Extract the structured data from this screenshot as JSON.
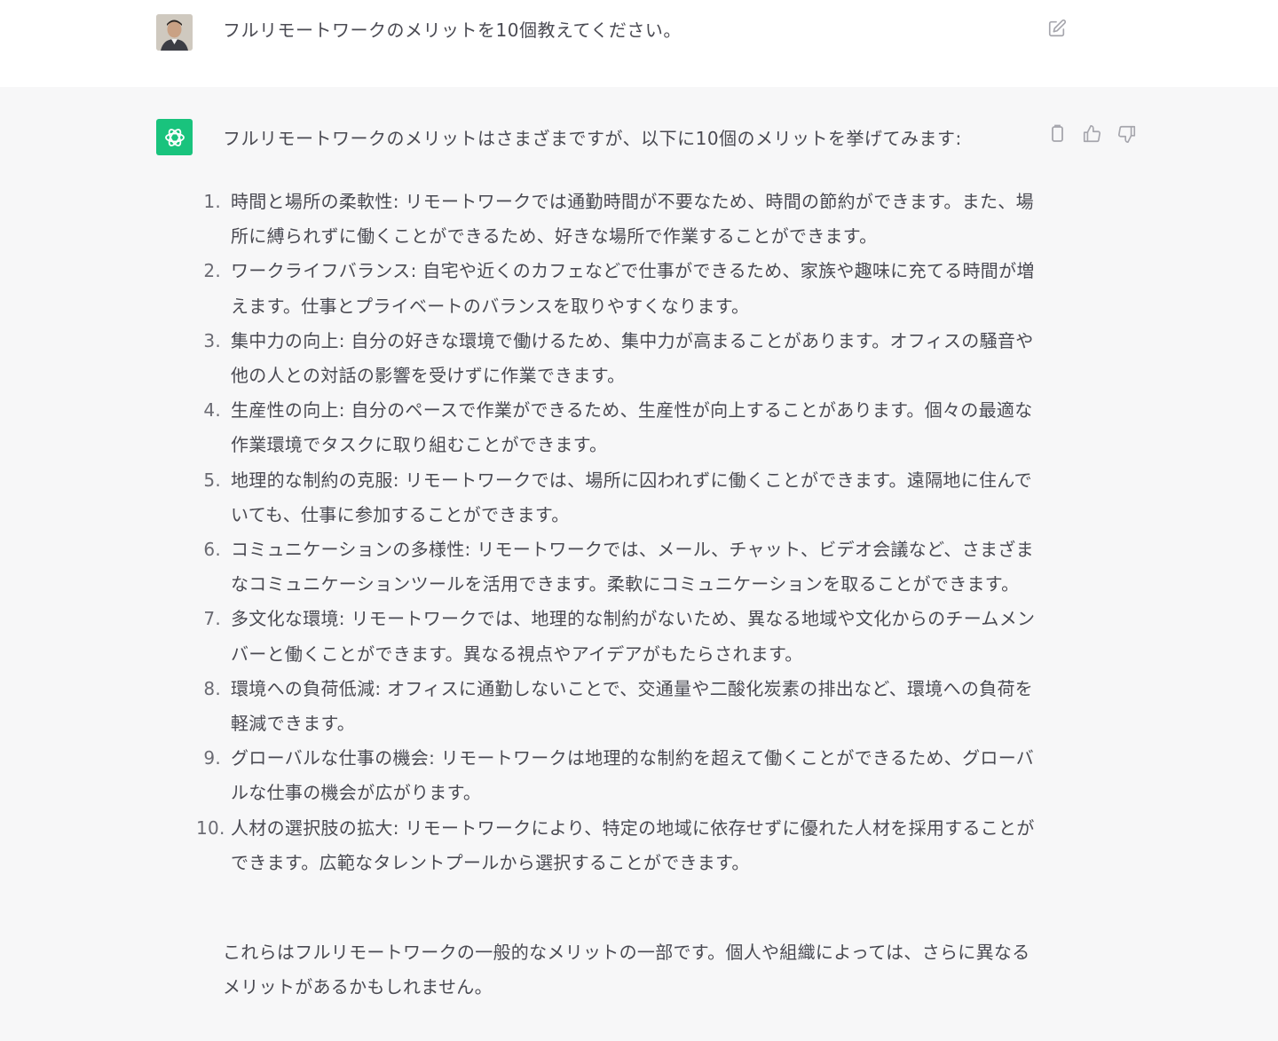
{
  "user_message": {
    "text": "フルリモートワークのメリットを10個教えてください。",
    "avatar_icon": "user-photo-avatar",
    "edit_icon": "edit-icon"
  },
  "assistant_message": {
    "intro": "フルリモートワークのメリットはさまざまですが、以下に10個のメリットを挙げてみます:",
    "avatar_icon": "chatgpt-logo-icon",
    "avatar_color": "#19c37d",
    "actions": [
      "copy-icon",
      "thumbs-up-icon",
      "thumbs-down-icon"
    ],
    "items": [
      {
        "num": "1.",
        "text": "時間と場所の柔軟性: リモートワークでは通勤時間が不要なため、時間の節約ができます。また、場所に縛られずに働くことができるため、好きな場所で作業することができます。"
      },
      {
        "num": "2.",
        "text": "ワークライフバランス: 自宅や近くのカフェなどで仕事ができるため、家族や趣味に充てる時間が増えます。仕事とプライベートのバランスを取りやすくなります。"
      },
      {
        "num": "3.",
        "text": "集中力の向上: 自分の好きな環境で働けるため、集中力が高まることがあります。オフィスの騒音や他の人との対話の影響を受けずに作業できます。"
      },
      {
        "num": "4.",
        "text": "生産性の向上: 自分のペースで作業ができるため、生産性が向上することがあります。個々の最適な作業環境でタスクに取り組むことができます。"
      },
      {
        "num": "5.",
        "text": "地理的な制約の克服: リモートワークでは、場所に囚われずに働くことができます。遠隔地に住んでいても、仕事に参加することができます。"
      },
      {
        "num": "6.",
        "text": "コミュニケーションの多様性: リモートワークでは、メール、チャット、ビデオ会議など、さまざまなコミュニケーションツールを活用できます。柔軟にコミュニケーションを取ることができます。"
      },
      {
        "num": "7.",
        "text": "多文化な環境: リモートワークでは、地理的な制約がないため、異なる地域や文化からのチームメンバーと働くことができます。異なる視点やアイデアがもたらされます。"
      },
      {
        "num": "8.",
        "text": "環境への負荷低減: オフィスに通勤しないことで、交通量や二酸化炭素の排出など、環境への負荷を軽減できます。"
      },
      {
        "num": "9.",
        "text": "グローバルな仕事の機会: リモートワークは地理的な制約を超えて働くことができるため、グローバルな仕事の機会が広がります。"
      },
      {
        "num": "10.",
        "text": "人材の選択肢の拡大: リモートワークにより、特定の地域に依存せずに優れた人材を採用することができます。広範なタレントプールから選択することができます。"
      }
    ],
    "closing": "これらはフルリモートワークの一般的なメリットの一部です。個人や組織によっては、さらに異なるメリットがあるかもしれません。"
  }
}
